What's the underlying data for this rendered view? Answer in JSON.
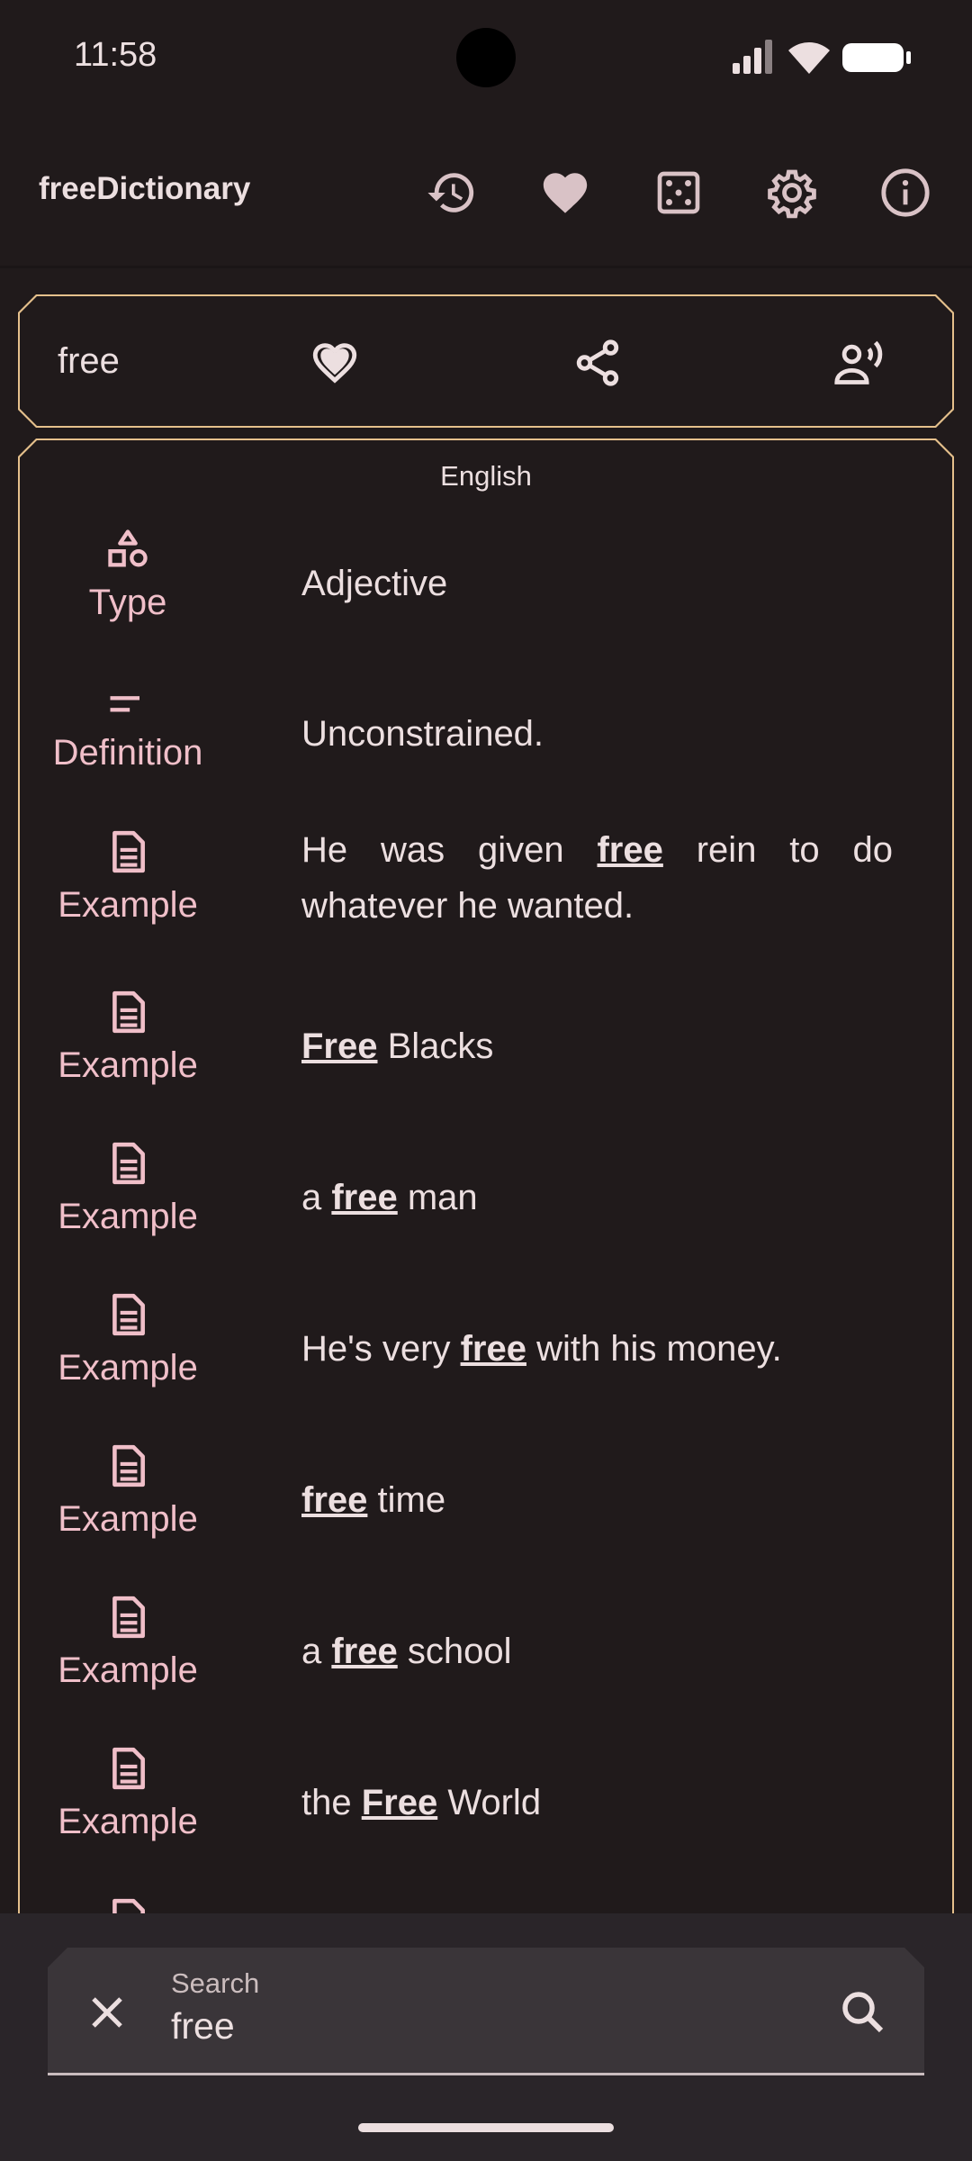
{
  "status_bar": {
    "time": "11:58"
  },
  "app_bar": {
    "title": "freeDictionary",
    "actions": [
      "history-icon",
      "favorite-icon",
      "random-dice-icon",
      "settings-icon",
      "info-icon"
    ]
  },
  "word_card": {
    "word": "free"
  },
  "definition": {
    "language": "English",
    "rows": [
      {
        "label": "Type",
        "icon": "shapes-icon",
        "text": "Adjective"
      },
      {
        "label": "Definition",
        "icon": "short-text-icon",
        "text": "Unconstrained."
      },
      {
        "label": "Example",
        "icon": "article-icon",
        "before": "He was given ",
        "bold": "free",
        "after": " rein to do whatever he wanted."
      },
      {
        "label": "Example",
        "icon": "article-icon",
        "before": "",
        "bold": "Free",
        "after": " Blacks"
      },
      {
        "label": "Example",
        "icon": "article-icon",
        "before": "a ",
        "bold": "free",
        "after": " man"
      },
      {
        "label": "Example",
        "icon": "article-icon",
        "before": "He's very ",
        "bold": "free",
        "after": " with his money."
      },
      {
        "label": "Example",
        "icon": "article-icon",
        "before": "",
        "bold": "free",
        "after": " time"
      },
      {
        "label": "Example",
        "icon": "article-icon",
        "before": "a ",
        "bold": "free",
        "after": " school"
      },
      {
        "label": "Example",
        "icon": "article-icon",
        "before": "the ",
        "bold": "Free",
        "after": " World"
      }
    ]
  },
  "search": {
    "label": "Search",
    "value": "free"
  },
  "colors": {
    "accent": "#e5c08c",
    "icon_pink": "#f0bfc9",
    "background": "#201a1b"
  }
}
